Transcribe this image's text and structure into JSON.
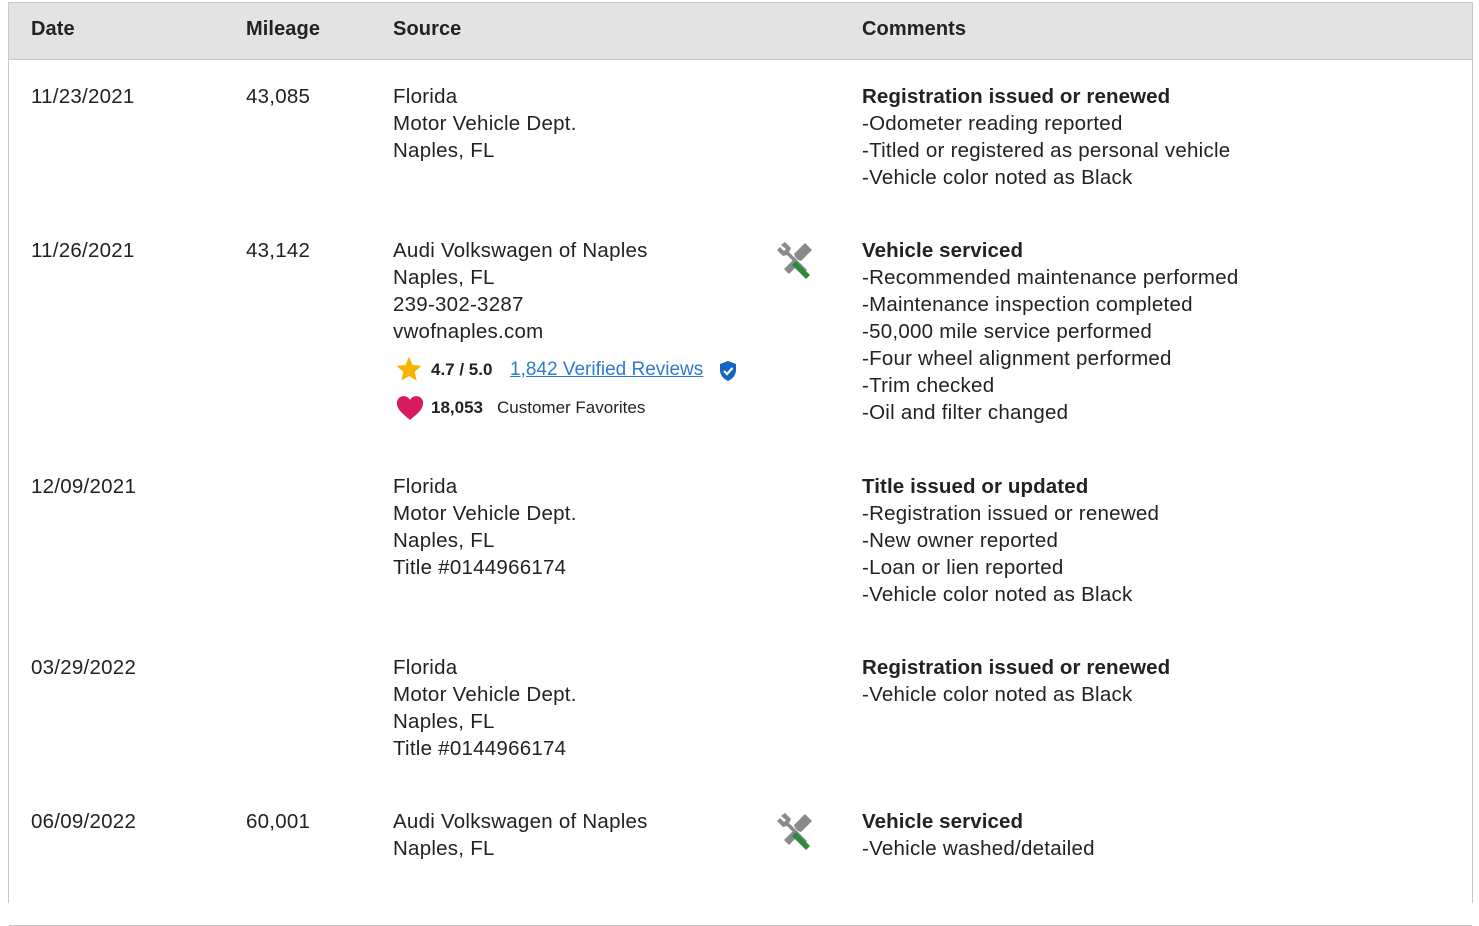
{
  "headers": {
    "date": "Date",
    "mileage": "Mileage",
    "source": "Source",
    "comments": "Comments"
  },
  "rows": [
    {
      "date": "11/23/2021",
      "mileage": "43,085",
      "source": [
        "Florida",
        "Motor Vehicle Dept.",
        "Naples, FL"
      ],
      "comment_title": "Registration issued or renewed",
      "comment_items": [
        "Odometer reading reported",
        "Titled or registered as personal vehicle",
        "Vehicle color noted as Black"
      ]
    },
    {
      "date": "11/26/2021",
      "mileage": "43,142",
      "source": [
        "Audi Volkswagen of Naples",
        "Naples, FL",
        "239-302-3287",
        "vwofnaples.com"
      ],
      "service_icon": "wrench-screwdriver-icon",
      "rating": {
        "value": "4.7 / 5.0",
        "reviews_link": "1,842 Verified Reviews",
        "favorites_count": "18,053",
        "favorites_label": "Customer Favorites"
      },
      "comment_title": "Vehicle serviced",
      "comment_items": [
        "Recommended maintenance performed",
        "Maintenance inspection completed",
        "50,000 mile service performed",
        "Four wheel alignment performed",
        "Trim checked",
        "Oil and filter changed"
      ]
    },
    {
      "date": "12/09/2021",
      "mileage": "",
      "source": [
        "Florida",
        "Motor Vehicle Dept.",
        "Naples, FL",
        "Title #0144966174"
      ],
      "comment_title": "Title issued or updated",
      "comment_items": [
        "Registration issued or renewed",
        "New owner reported",
        "Loan or lien reported",
        "Vehicle color noted as Black"
      ]
    },
    {
      "date": "03/29/2022",
      "mileage": "",
      "source": [
        "Florida",
        "Motor Vehicle Dept.",
        "Naples, FL",
        "Title #0144966174"
      ],
      "comment_title": "Registration issued or renewed",
      "comment_items": [
        "Vehicle color noted as Black"
      ]
    },
    {
      "date": "06/09/2022",
      "mileage": "60,001",
      "source": [
        "Audi Volkswagen of Naples",
        "Naples, FL"
      ],
      "service_icon": "wrench-screwdriver-icon",
      "comment_title": "Vehicle serviced",
      "comment_items": [
        "Vehicle washed/detailed"
      ]
    }
  ],
  "colors": {
    "header_bg": "#e3e3e3",
    "border": "#c8c8c8",
    "link": "#2d7bd2",
    "star": "#f6b400",
    "heart": "#d81b60",
    "shield": "#1565c0",
    "screwdriver": "#2e8b3a",
    "wrench": "#8a8a8a"
  }
}
